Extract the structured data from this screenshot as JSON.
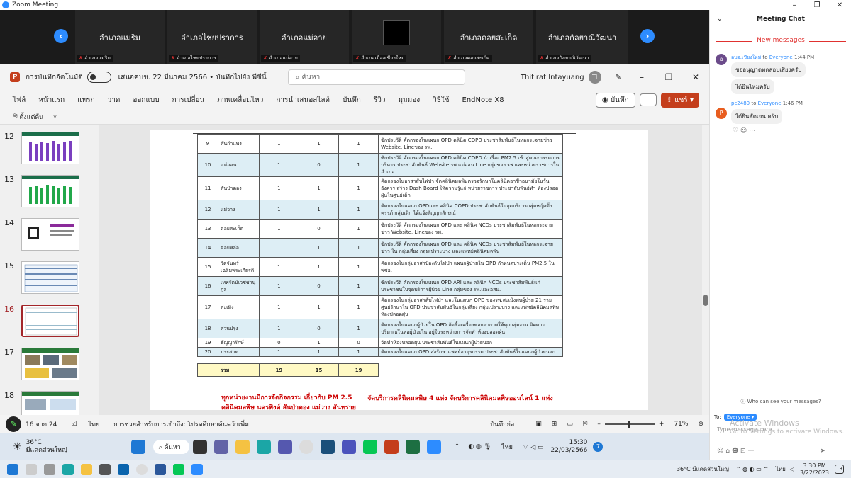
{
  "window": {
    "title": "Zoom Meeting"
  },
  "gallery": {
    "tiles": [
      {
        "name": "อำเภอแม่ริม",
        "label": "อำเภอแม่ริม"
      },
      {
        "name": "อำเภอไชยปราการ",
        "label": "อำเภอไชยปราการ"
      },
      {
        "name": "อำเภอแม่อาย",
        "label": "อำเภอแม่อาย"
      },
      {
        "name": "",
        "label": "อำเภอเมืองเชียงใหม่"
      },
      {
        "name": "อำเภอดอยสะเก็ด",
        "label": "อำเภอดอยสะเก็ด"
      },
      {
        "name": "อำเภอกัลยาณิวัฒนา",
        "label": "อำเภอกัลยาณิวัฒนา"
      }
    ]
  },
  "ppt": {
    "autosave": "การบันทึกอัตโนมัติ",
    "doc_title": "เสนอคบช. 22 มีนาคม 2566 • บันทึกไปยัง พีซีนี้",
    "search_placeholder": "ค้นหา",
    "user_name": "Thitirat Intayuang",
    "user_initials": "TI",
    "tabs": [
      "ไฟล์",
      "หน้าแรก",
      "แทรก",
      "วาด",
      "ออกแบบ",
      "การเปลี่ยน",
      "ภาพเคลื่อนไหว",
      "การนำเสนอสไลด์",
      "บันทึก",
      "รีวิว",
      "มุมมอง",
      "วิธีใช้",
      "EndNote X8"
    ],
    "record_label": "บันทึก",
    "share_label": "แชร์",
    "qa_label": "ตั้งแต่ต้น",
    "thumbs": [
      "12",
      "13",
      "14",
      "15",
      "16",
      "17",
      "18"
    ],
    "status": {
      "slide_count": "16 จาก 24",
      "lang": "ไทย",
      "access": "การช่วยสำหรับการเข้าถึง: โปรดศึกษาค้นคว้าเพิ่ม",
      "notes": "บันทึกย่อ",
      "zoom": "71%"
    }
  },
  "table": {
    "rows": [
      {
        "n": "9",
        "name": "สันกำแพง",
        "c1": "1",
        "c2": "1",
        "c3": "1",
        "desc": "ซักประวัติ คัดกรองในแผนก OPD คลินิค COPD ประชาสัมพันธ์ในหอกระจายข่าว Website, Lineของ รพ.",
        "alt": false
      },
      {
        "n": "10",
        "name": "แม่ออน",
        "c1": "1",
        "c2": "0",
        "c3": "1",
        "desc": "ซักประวัติ คัดกรองในแผนก OPD คลินิค COPD นำเรื่อง PM2.5 เข้าสู่คณะกรรมการบริหาร ประชาสัมพันธ์ Website รพ.แม่ออน Line กลุ่มของ รพ.และหน่วยราชการในอำเภอ",
        "alt": true
      },
      {
        "n": "11",
        "name": "สันป่าตอง",
        "c1": "1",
        "c2": "1",
        "c3": "1",
        "desc": "คัดกรองในอาสาสับไฟป่า จัดคลินิคมลพิษตรวจรักษาในคลินิคอาชีวอนามัยในวันอังคาร สร้าง Dash Board ให้ความรู้แก่ หน่วยราชการ ประชาสัมพันธ์ทำ ห้องปลอดฝุ่นในศูนย์เด็ก",
        "alt": false
      },
      {
        "n": "12",
        "name": "แม่วาง",
        "c1": "1",
        "c2": "1",
        "c3": "1",
        "desc": "คัดกรองในแผนก OPDและ คลินิค COPD ประชาสัมพันธ์ในจุดบริการกลุ่มหญิงตั้งครรภ์ กลุ่มเด็ก ได้แจ้งสัญญาลักษณ์",
        "alt": true
      },
      {
        "n": "13",
        "name": "ดอยสะเก็ด",
        "c1": "1",
        "c2": "0",
        "c3": "1",
        "desc": "ซักประวัติ คัดกรองในแผนก OPD และ คลินิค NCDs ประชาสัมพันธ์ในหอกระจายข่าว Website, Lineของ รพ.",
        "alt": false
      },
      {
        "n": "14",
        "name": "ดอยหล่อ",
        "c1": "1",
        "c2": "1",
        "c3": "1",
        "desc": "ซักประวัติ คัดกรองในแผนก OPD และ คลินิค NCDs ประชาสัมพันธ์ในหอกระจายข่าว ใน กลุ่มเสี่ยง กลุ่มเปราะบาง และแพทย์คลินิคมลพิษ",
        "alt": true
      },
      {
        "n": "15",
        "name": "วัดจันทร์เฉลิมพระเกียรติ",
        "c1": "1",
        "c2": "1",
        "c3": "1",
        "desc": "คัดกรองในกลุ่มอาสาป้องกันไฟป่า แผนกผู้ป่วยใน OPD กำหนดประเด็น PM2.5 ใน พชอ.",
        "alt": false
      },
      {
        "n": "16",
        "name": "เทพรัตน์เวชชานุกูล",
        "c1": "1",
        "c2": "0",
        "c3": "1",
        "desc": "ซักประวัติ คัดกรองในแผนก OPD ARI และ คลินิค NCDs ประชาสัมพันธ์แก่ประชาชนในจุดบริการผู้ป่วย Line กลุ่มของ รพ.และอสม.",
        "alt": true
      },
      {
        "n": "17",
        "name": "สะเมิง",
        "c1": "1",
        "c2": "1",
        "c3": "1",
        "desc": "คัดกรองในกลุ่มอาสาดับไฟป่า และในแผนก OPD ของรพ.สะเมิงพบผู้ป่วย 21 ราย ศูนย์รักษาใน OPD ประชาสัมพันธ์ในกลุ่มเสี่ยง กลุ่มเปราะบาง และแพทย์คลินิคมลพิษ ห้องปลอดฝุ่น",
        "alt": false
      },
      {
        "n": "18",
        "name": "สวนปรุง",
        "c1": "1",
        "c2": "0",
        "c3": "1",
        "desc": "คัดกรองในแผนกผู้ป่วยใน OPD จัดซื้อเครื่องฟอกอากาศให้ทุกกลุ่มงาน ติดตามปริมาณในหอผู้ป่วยใน อยู่ในระหว่างการจัดทำห้องปลอดฝุ่น",
        "alt": true
      },
      {
        "n": "19",
        "name": "ธัญญารักษ์",
        "c1": "0",
        "c2": "1",
        "c3": "0",
        "desc": "จัดทำห้องปลอดฝุ่น ประชาสัมพันธ์ในแผนกผู้ป่วยนอก",
        "alt": false,
        "short": true
      },
      {
        "n": "20",
        "name": "ประสาท",
        "c1": "1",
        "c2": "1",
        "c3": "1",
        "desc": "คัดกรองในแผนก OPD ส่งรักษาแพทย์อายุรกรรม ประชาสัมพันธ์ในแผนกผู้ป่วยนอก",
        "alt": true,
        "short": true
      }
    ],
    "total": {
      "label": "รวม",
      "c1": "19",
      "c2": "15",
      "c3": "19"
    },
    "footnote1": "ทุกหน่วยงานมีการจัดกิจกรรม เกี่ยวกับ PM 2.5",
    "footnote1b": "คลินิคมลพิษ    นครพิงค์ สันป่าตอง แม่วาง สันทราย",
    "footnote2": "จัดบริการคลินิคมลพิษ 4 แห่ง  จัดบริการคลินิคมลพิษออนไลน์ 1 แห่ง"
  },
  "taskbar1": {
    "temp": "36°C",
    "weather": "มีแดดส่วนใหญ่",
    "search": "ค้นหา",
    "lang": "ไทย",
    "time": "15:30",
    "date": "22/03/2566",
    "badge": "7"
  },
  "chat": {
    "title": "Meeting Chat",
    "new_messages": "New messages",
    "messages": [
      {
        "sender": "อบจ.เชียงใหม่",
        "to": "Everyone",
        "time": "1:44 PM",
        "lines": [
          "ขออนุญาตทดสอบเสียงครับ",
          "ได้ยินไหมครับ"
        ],
        "avatar_color": "#6b4b8a",
        "avatar": "อ"
      },
      {
        "sender": "pc2480",
        "to": "Everyone",
        "time": "1:46 PM",
        "lines": [
          "ได้ยินชัดเจน ครับ"
        ],
        "avatar_color": "#e85d1f",
        "avatar": "P"
      }
    ],
    "who_can_see": "Who can see your messages?",
    "to_label": "To:",
    "to_value": "Everyone",
    "type_placeholder": "Type message here...",
    "watermark1": "Activate Windows",
    "watermark2": "Go to Settings to activate Windows."
  },
  "taskbar2": {
    "weather": "36°C มีแดดส่วนใหญ่",
    "lang": "ไทย",
    "time": "3:30 PM",
    "date": "3/22/2023",
    "badge": "13"
  }
}
